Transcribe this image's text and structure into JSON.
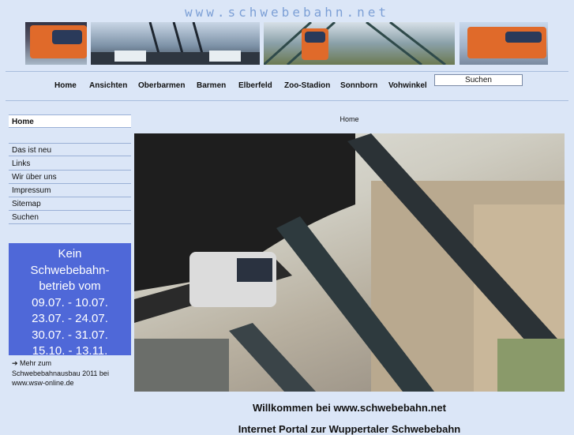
{
  "site_title": "www.schwebebahn.net",
  "nav": {
    "items": [
      "Home",
      "Ansichten",
      "Oberbarmen",
      "Barmen",
      "Elberfeld",
      "Zoo-Stadion",
      "Sonnborn",
      "Vohwinkel"
    ],
    "search_label": "Suchen"
  },
  "sidebar": {
    "items": [
      "Home",
      "Das ist neu",
      "Links",
      "Wir über uns",
      "Impressum",
      "Sitemap",
      "Suchen"
    ]
  },
  "notice": {
    "lines": [
      "Kein",
      "Schwebebahn-",
      "betrieb vom",
      "09.07. - 10.07.",
      "23.07. - 24.07.",
      "30.07. - 31.07.",
      "15.10. - 13.11."
    ]
  },
  "more_link": {
    "line1": "➔ Mehr zum",
    "line2": "Schwebebahnausbau 2011 bei",
    "line3": "www.wsw-online.de"
  },
  "breadcrumb": "Home",
  "welcome": "Willkommen bei www.schwebebahn.net",
  "portal": "Internet Portal zur Wuppertaler Schwebebahn",
  "colors": {
    "background": "#dbe6f7",
    "notice_bg": "#4f68d8",
    "title": "#7da0d6"
  }
}
